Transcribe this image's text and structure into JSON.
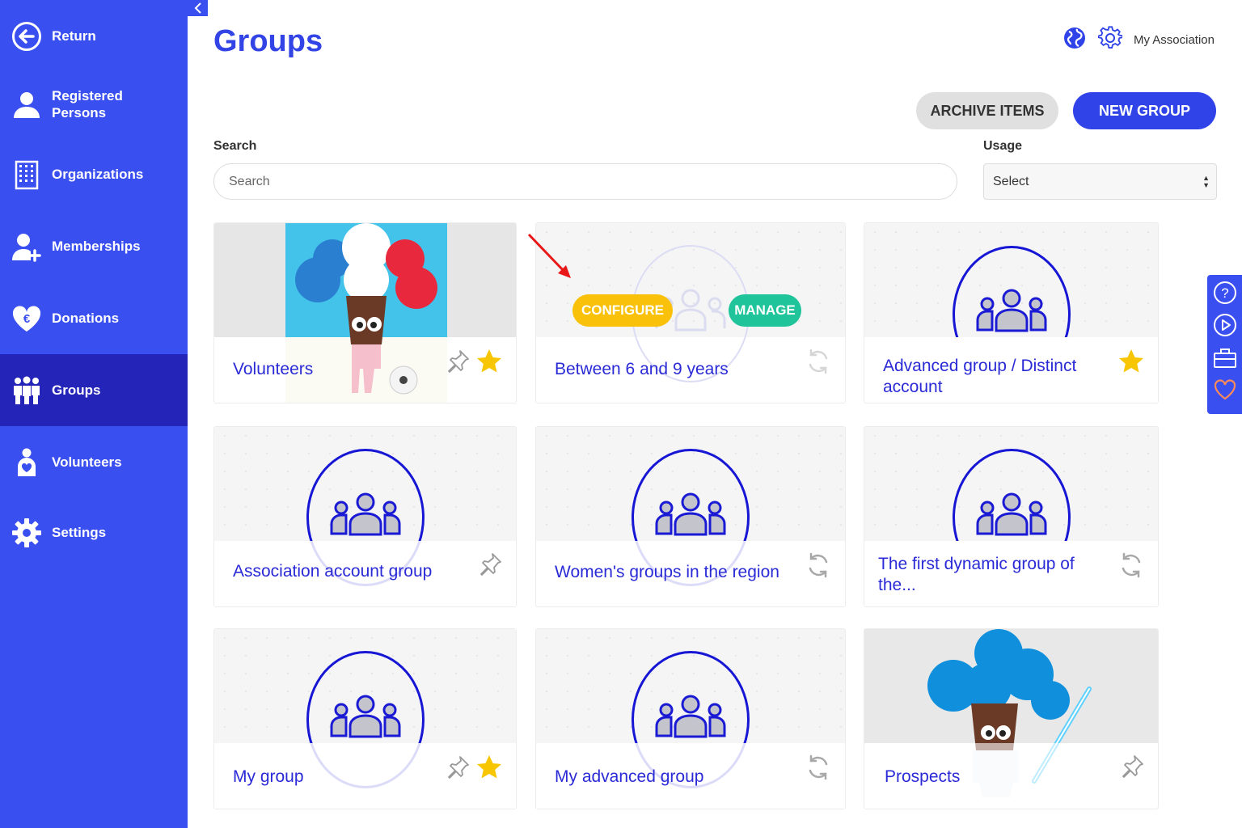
{
  "sidebar": {
    "items": [
      {
        "label": "Return",
        "icon": "arrow-left-circle-icon"
      },
      {
        "label": "Registered\nPersons",
        "icon": "person-icon"
      },
      {
        "label": "Organizations",
        "icon": "building-icon"
      },
      {
        "label": "Memberships",
        "icon": "person-add-icon"
      },
      {
        "label": "Donations",
        "icon": "heart-euro-icon"
      },
      {
        "label": "Groups",
        "icon": "people-icon",
        "active": true
      },
      {
        "label": "Volunteers",
        "icon": "volunteer-icon"
      },
      {
        "label": "Settings",
        "icon": "gear-icon"
      }
    ]
  },
  "header": {
    "title": "Groups",
    "association": "My Association"
  },
  "toolbar": {
    "archive_label": "ARCHIVE ITEMS",
    "new_group_label": "NEW GROUP"
  },
  "filters": {
    "search_label": "Search",
    "search_placeholder": "Search",
    "usage_label": "Usage",
    "usage_value": "Select"
  },
  "hover_actions": {
    "configure": "CONFIGURE",
    "manage": "MANAGE"
  },
  "cards": [
    {
      "title": "Volunteers",
      "pinned": true,
      "starred": true,
      "type": "illustration"
    },
    {
      "title": "Between 6 and 9 years",
      "dynamic": true,
      "hovered": true
    },
    {
      "title": "Advanced group / Distinct account",
      "starred": true
    },
    {
      "title": "Association account group",
      "pinned": true
    },
    {
      "title": "Women's groups in the region",
      "dynamic": true
    },
    {
      "title": "The first dynamic group of the...",
      "dynamic": true
    },
    {
      "title": "My group",
      "pinned": true,
      "starred": true
    },
    {
      "title": "My advanced group",
      "dynamic": true
    },
    {
      "title": "Prospects",
      "pinned": true,
      "type": "illustration"
    }
  ],
  "colors": {
    "sidebar": "#3a4ff0",
    "sidebar_active": "#2424b8",
    "accent": "#2f43e8",
    "configure": "#f9c10a",
    "manage": "#1fc49a",
    "star": "#f7c600"
  }
}
